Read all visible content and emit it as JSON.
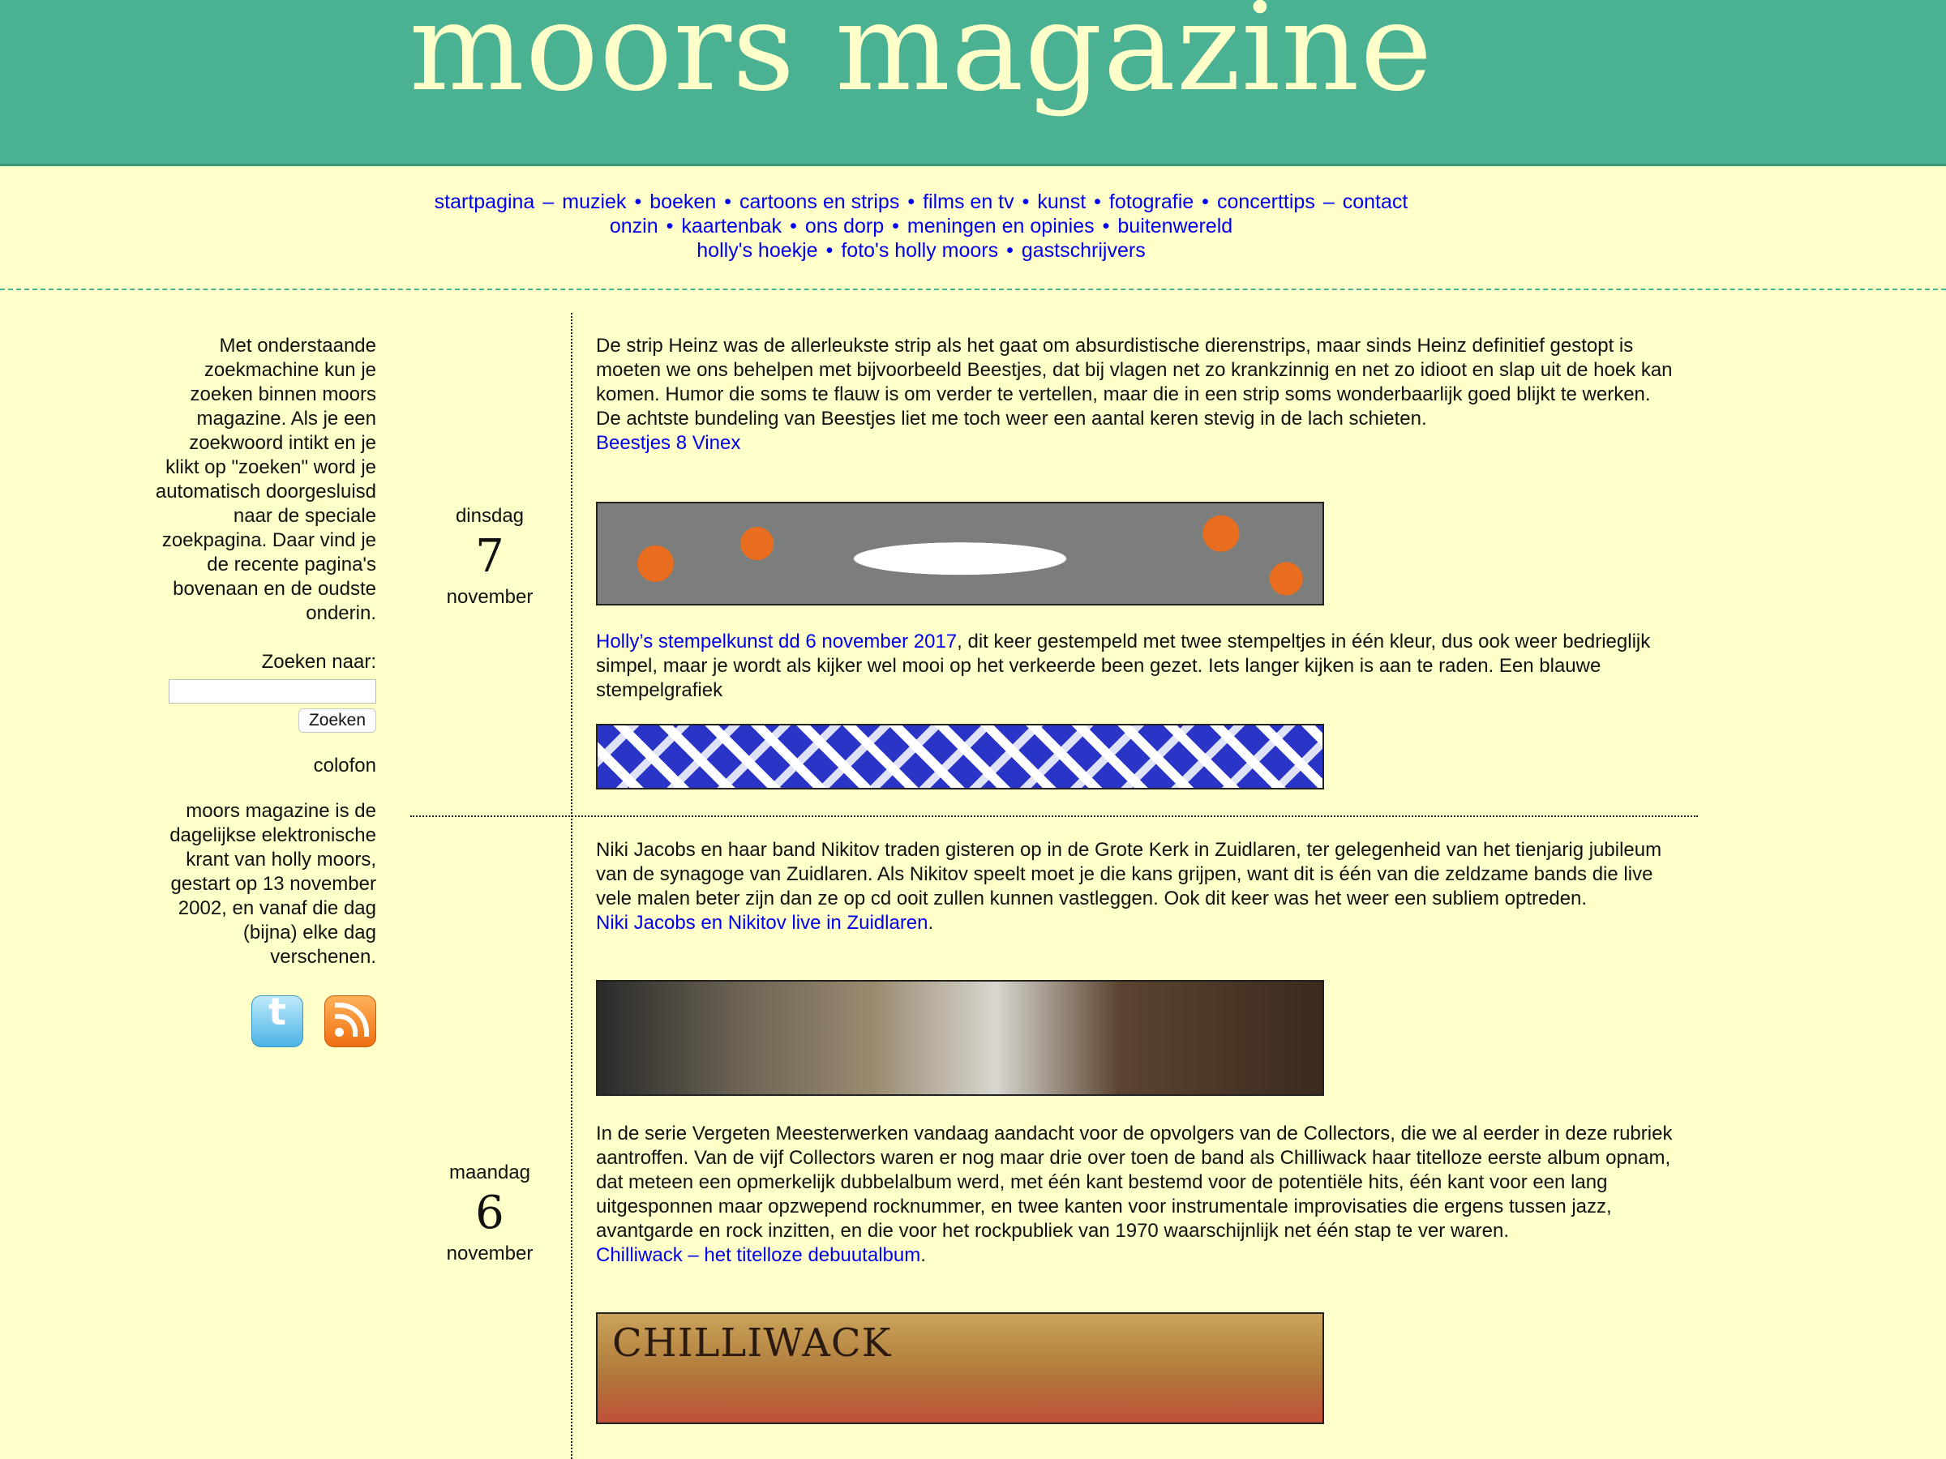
{
  "site": {
    "title": "moors magazine"
  },
  "nav": {
    "line1": [
      {
        "label": "startpagina",
        "sep": "–"
      },
      {
        "label": "muziek",
        "sep": "•"
      },
      {
        "label": "boeken",
        "sep": "•"
      },
      {
        "label": "cartoons en strips",
        "sep": "•"
      },
      {
        "label": "films en tv",
        "sep": "•"
      },
      {
        "label": "kunst",
        "sep": "•"
      },
      {
        "label": "fotografie",
        "sep": "•"
      },
      {
        "label": "concerttips",
        "sep": "–"
      },
      {
        "label": "contact",
        "sep": ""
      }
    ],
    "line2": [
      {
        "label": "onzin",
        "sep": "•"
      },
      {
        "label": "kaartenbak",
        "sep": "•"
      },
      {
        "label": "ons dorp",
        "sep": "•"
      },
      {
        "label": "meningen en opinies",
        "sep": "•"
      },
      {
        "label": "buitenwereld",
        "sep": ""
      }
    ],
    "line3": [
      {
        "label": "holly's hoekje",
        "sep": "•"
      },
      {
        "label": "foto's holly moors",
        "sep": "•"
      },
      {
        "label": "gastschrijvers",
        "sep": ""
      }
    ]
  },
  "sidebar": {
    "intro": "Met onderstaande zoekmachine kun je zoeken binnen moors magazine. Als je een zoekwoord intikt en je klikt op \"zoeken\" word je automatisch doorgesluisd naar de speciale zoekpagina. Daar vind je de recente pagina's bovenaan en de oudste onderin.",
    "search_label": "Zoeken naar:",
    "search_value": "",
    "search_button": "Zoeken",
    "colofon": "colofon",
    "about": "moors magazine is de dagelijkse elektronische krant van holly moors, gestart op 13 november 2002, en vanaf die dag (bijna) elke dag verschenen.",
    "icons": [
      "twitter-icon",
      "rss-icon"
    ]
  },
  "dates": [
    {
      "dow": "dinsdag",
      "day": "7",
      "month": "november"
    },
    {
      "dow": "maandag",
      "day": "6",
      "month": "november"
    }
  ],
  "articles": [
    {
      "text": "De strip Heinz was de allerleukste strip als het gaat om absurdistische dierenstrips, maar sinds Heinz definitief gestopt is moeten we ons behelpen met bijvoorbeeld Beestjes, dat bij vlagen net zo krankzinnig en net zo idioot en slap uit de hoek kan komen. Humor die soms te flauw is om verder te vertellen, maar die in een strip soms wonderbaarlijk goed blijkt te werken. De achtste bundeling van Beestjes liet me toch weer een aantal keren stevig in de lach schieten.",
      "link": "Beestjes 8 Vinex",
      "link_after": ""
    },
    {
      "link": "Holly’s stempelkunst dd 6 november 2017",
      "text": ", dit keer gestempeld met twee stempeltjes in één kleur, dus ook weer bedrieglijk simpel, maar je wordt als kijker wel mooi op het verkeerde been gezet. Iets langer kijken is aan te raden. Een blauwe stempelgrafiek"
    },
    {
      "text": "Niki Jacobs en haar band Nikitov traden gisteren op in de Grote Kerk in Zuidlaren, ter gelegenheid van het tienjarig jubileum van de synagoge van Zuidlaren. Als Nikitov speelt moet je die kans grijpen, want dit is één van die zeldzame bands die live vele malen beter zijn dan ze op cd ooit zullen kunnen vastleggen. Ook dit keer was het weer een subliem optreden.",
      "link": "Niki Jacobs en Nikitov live in Zuidlaren",
      "link_after": "."
    },
    {
      "text": "In de serie Vergeten Meesterwerken vandaag aandacht voor de opvolgers van de Collectors, die we al eerder in deze rubriek aantroffen. Van de vijf Collectors waren er nog maar drie over toen de band als Chilliwack haar titelloze eerste album opnam, dat meteen een opmerkelijk dubbelalbum werd, met één kant bestemd voor de potentiële hits, één kant voor een lang uitgesponnen maar opzwepend rocknummer, en twee kanten voor instrumentale improvisaties die ergens tussen jazz, avantgarde en rock inzitten, en die voor het rockpubliek van 1970 waarschijnlijk net één stap te ver waren.",
      "link": "Chilliwack – het titelloze debuutalbum",
      "link_after": ".",
      "image_text": "CHILLIWACK"
    }
  ]
}
